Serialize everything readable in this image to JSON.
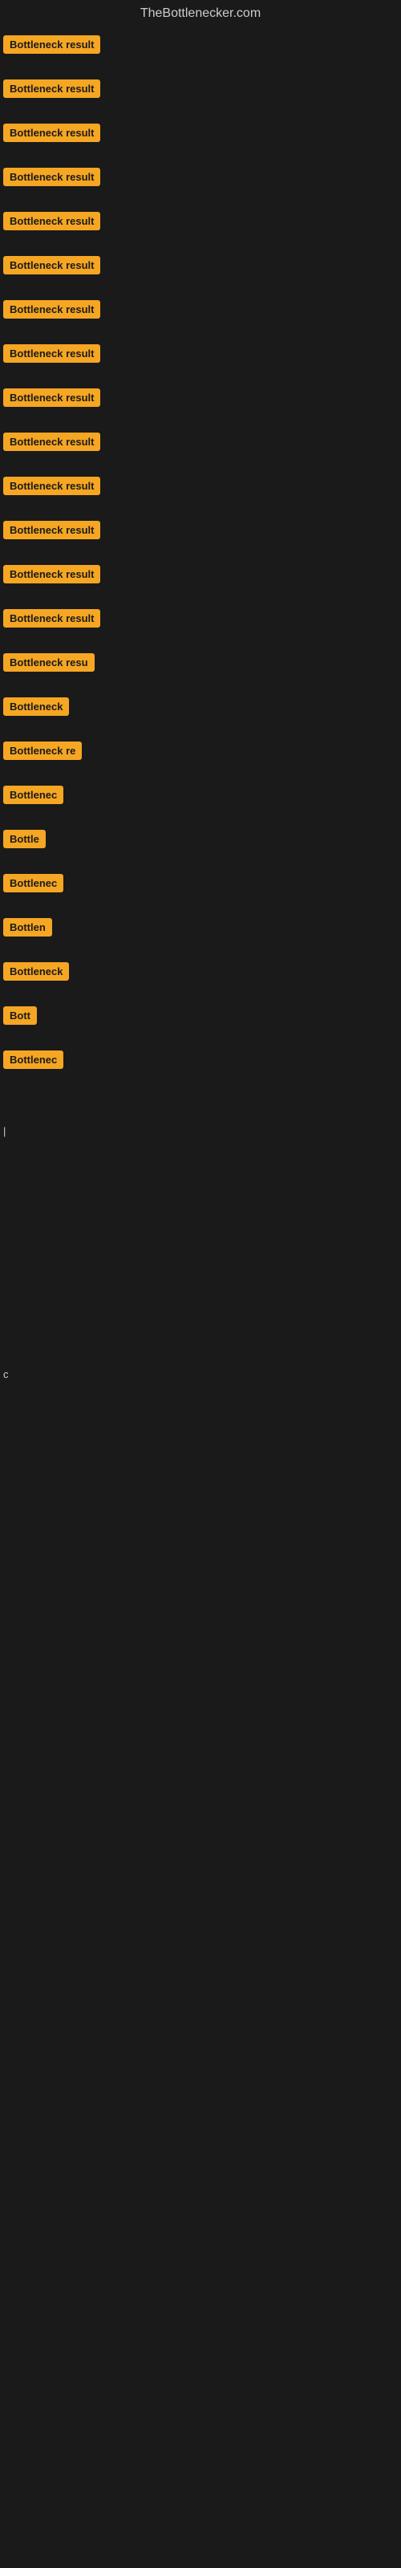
{
  "site": {
    "title": "TheBottlenecker.com"
  },
  "colors": {
    "badge_bg": "#f5a623",
    "badge_text": "#1a1a1a",
    "background": "#1a1a1a",
    "site_title": "#cccccc"
  },
  "items": [
    {
      "id": 1,
      "label": "Bottleneck result",
      "badge_class": "badge-full",
      "top_spacer": false
    },
    {
      "id": 2,
      "label": "Bottleneck result",
      "badge_class": "badge-full",
      "top_spacer": true
    },
    {
      "id": 3,
      "label": "Bottleneck result",
      "badge_class": "badge-full",
      "top_spacer": true
    },
    {
      "id": 4,
      "label": "Bottleneck result",
      "badge_class": "badge-full",
      "top_spacer": true
    },
    {
      "id": 5,
      "label": "Bottleneck result",
      "badge_class": "badge-full",
      "top_spacer": true
    },
    {
      "id": 6,
      "label": "Bottleneck result",
      "badge_class": "badge-full",
      "top_spacer": true
    },
    {
      "id": 7,
      "label": "Bottleneck result",
      "badge_class": "badge-full",
      "top_spacer": true
    },
    {
      "id": 8,
      "label": "Bottleneck result",
      "badge_class": "badge-full",
      "top_spacer": true
    },
    {
      "id": 9,
      "label": "Bottleneck result",
      "badge_class": "badge-full",
      "top_spacer": true
    },
    {
      "id": 10,
      "label": "Bottleneck result",
      "badge_class": "badge-full",
      "top_spacer": true
    },
    {
      "id": 11,
      "label": "Bottleneck result",
      "badge_class": "badge-full",
      "top_spacer": true
    },
    {
      "id": 12,
      "label": "Bottleneck result",
      "badge_class": "badge-full",
      "top_spacer": true
    },
    {
      "id": 13,
      "label": "Bottleneck result",
      "badge_class": "badge-full",
      "top_spacer": true
    },
    {
      "id": 14,
      "label": "Bottleneck result",
      "badge_class": "badge-full",
      "top_spacer": true
    },
    {
      "id": 15,
      "label": "Bottleneck resu",
      "badge_class": "badge-large",
      "top_spacer": true
    },
    {
      "id": 16,
      "label": "Bottleneck",
      "badge_class": "badge-medium",
      "top_spacer": true
    },
    {
      "id": 17,
      "label": "Bottleneck re",
      "badge_class": "badge-medium-large",
      "top_spacer": true
    },
    {
      "id": 18,
      "label": "Bottlenec",
      "badge_class": "badge-small-medium",
      "top_spacer": true
    },
    {
      "id": 19,
      "label": "Bottle",
      "badge_class": "badge-small",
      "top_spacer": true
    },
    {
      "id": 20,
      "label": "Bottlenec",
      "badge_class": "badge-small-medium",
      "top_spacer": true
    },
    {
      "id": 21,
      "label": "Bottlen",
      "badge_class": "badge-xsmall",
      "top_spacer": true
    },
    {
      "id": 22,
      "label": "Bottleneck",
      "badge_class": "badge-medium",
      "top_spacer": true
    },
    {
      "id": 23,
      "label": "Bott",
      "badge_class": "badge-xxsmall",
      "top_spacer": true
    },
    {
      "id": 24,
      "label": "Bottlenec",
      "badge_class": "badge-small-medium",
      "top_spacer": true
    }
  ],
  "single_char": {
    "label": "|",
    "visible": true
  },
  "bottom_char": {
    "label": "c",
    "visible": true
  }
}
